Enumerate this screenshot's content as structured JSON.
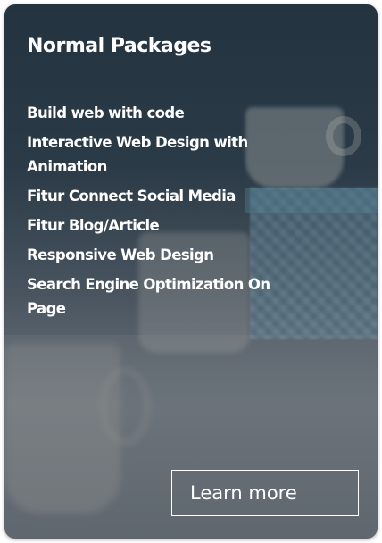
{
  "card": {
    "title": "Normal Packages",
    "features": [
      "Build web with code",
      "Interactive Web Design with Animation",
      "Fitur Connect Social Media",
      "Fitur Blog/Article",
      "Responsive Web Design",
      "Search Engine Optimization On Page"
    ],
    "button_label": "Learn more"
  },
  "colors": {
    "text": "#ffffff",
    "overlay": "#233340"
  }
}
